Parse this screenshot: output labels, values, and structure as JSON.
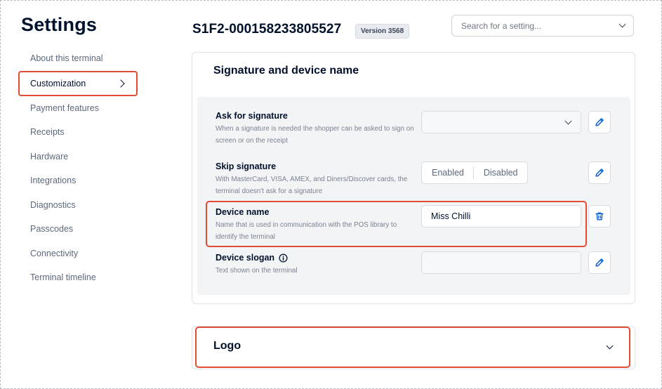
{
  "sidebar": {
    "title": "Settings",
    "items": [
      {
        "label": "About this terminal"
      },
      {
        "label": "Customization",
        "active": true
      },
      {
        "label": "Payment features"
      },
      {
        "label": "Receipts"
      },
      {
        "label": "Hardware"
      },
      {
        "label": "Integrations"
      },
      {
        "label": "Diagnostics"
      },
      {
        "label": "Passcodes"
      },
      {
        "label": "Connectivity"
      },
      {
        "label": "Terminal timeline"
      }
    ]
  },
  "header": {
    "terminal_id": "S1F2-000158233805527",
    "version_badge": "Version 3568",
    "search": {
      "placeholder": "Search for a setting...",
      "icon": "chevron-down-icon"
    }
  },
  "signature_section": {
    "title": "Signature and device name",
    "settings": {
      "ask_for_signature": {
        "label": "Ask for signature",
        "description": "When a signature is needed the shopper can be asked to sign on screen or on the receipt",
        "value": "",
        "action_icon": "pencil-icon"
      },
      "skip_signature": {
        "label": "Skip signature",
        "description": "With MasterCard, VISA, AMEX, and Diners/Discover cards, the terminal doesn't ask for a signature",
        "options": [
          "Enabled",
          "Disabled"
        ],
        "action_icon": "pencil-icon"
      },
      "device_name": {
        "label": "Device name",
        "description": "Name that is used in communication with the POS library to identify the terminal",
        "value": "Miss Chilli",
        "action_icon": "trash-icon"
      },
      "device_slogan": {
        "label": "Device slogan",
        "description": "Text shown on the terminal",
        "value": "",
        "label_icon": "info-icon",
        "action_icon": "pencil-icon"
      }
    }
  },
  "logo_section": {
    "title": "Logo",
    "icon": "chevron-down-icon"
  },
  "colors": {
    "highlight": "#e24b34",
    "text_primary": "#00112c",
    "text_secondary": "#5c687c",
    "accent": "#0abf53",
    "panel_background": "#f3f4f6"
  }
}
